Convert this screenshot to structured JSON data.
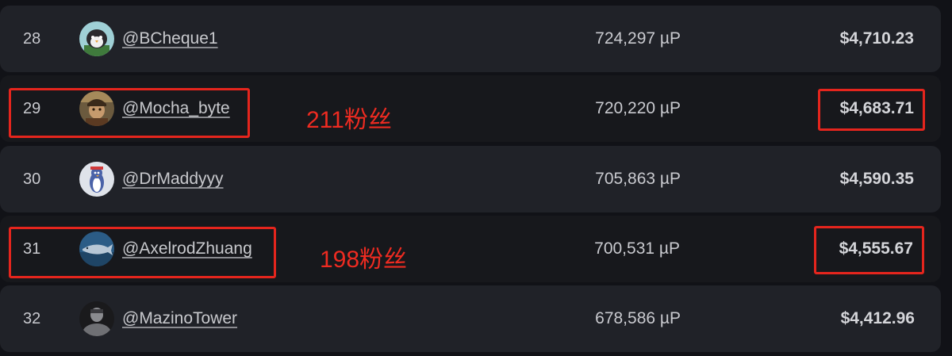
{
  "rows": [
    {
      "rank": "28",
      "handle": "@BCheque1",
      "points": "724,297 µP",
      "earnings": "$4,710.23"
    },
    {
      "rank": "29",
      "handle": "@Mocha_byte",
      "points": "720,220 µP",
      "earnings": "$4,683.71"
    },
    {
      "rank": "30",
      "handle": "@DrMaddyyy",
      "points": "705,863 µP",
      "earnings": "$4,590.35"
    },
    {
      "rank": "31",
      "handle": "@AxelrodZhuang",
      "points": "700,531 µP",
      "earnings": "$4,555.67"
    },
    {
      "rank": "32",
      "handle": "@MazinoTower",
      "points": "678,586 µP",
      "earnings": "$4,412.96"
    }
  ],
  "annotations": {
    "note_29": "211粉丝",
    "note_31": "198粉丝",
    "color": "#e5251d"
  },
  "colors": {
    "background": "#111217",
    "row_light": "#202228",
    "row_dark": "#17181c",
    "text": "#c9cacf"
  }
}
